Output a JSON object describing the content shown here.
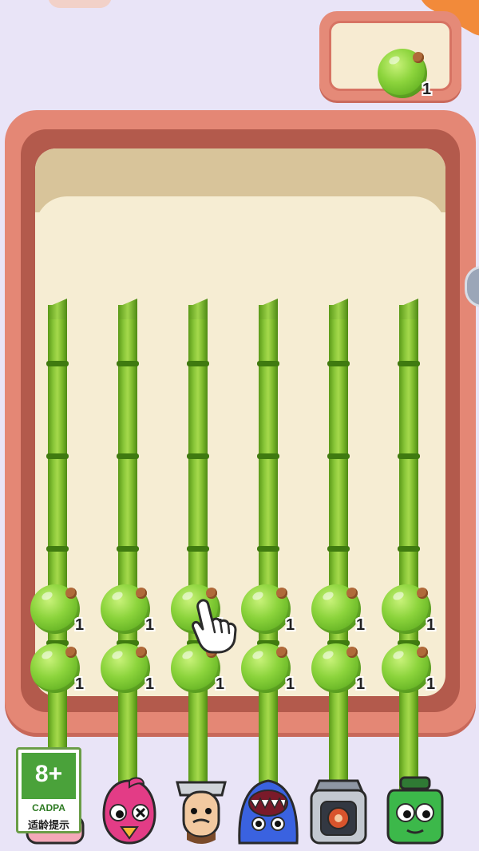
{
  "target": {
    "item": "green-fruit-ball",
    "count": "1"
  },
  "rods": [
    {
      "balls": [
        {
          "count": "1"
        },
        {
          "count": "1"
        }
      ]
    },
    {
      "balls": [
        {
          "count": "1"
        },
        {
          "count": "1"
        }
      ]
    },
    {
      "balls": [
        {
          "count": "1"
        },
        {
          "count": "1"
        }
      ]
    },
    {
      "balls": [
        {
          "count": "1"
        },
        {
          "count": "1"
        }
      ]
    },
    {
      "balls": [
        {
          "count": "1"
        },
        {
          "count": "1"
        }
      ]
    },
    {
      "balls": [
        {
          "count": "1"
        },
        {
          "count": "1"
        }
      ]
    }
  ],
  "characters": [
    "pink-bird-icon",
    "pink-monster-icon",
    "upside-down-man-icon",
    "blue-shark-monster-icon",
    "robot-box-icon",
    "green-bottle-monster-icon"
  ],
  "age_badge": {
    "age": "8+",
    "org": "CADPA",
    "tip": "适龄提示"
  },
  "colors": {
    "background": "#e9e4f7",
    "board": "#e48775",
    "board_inner": "#f6edd3",
    "bamboo": "#8bc83a",
    "ball": "#8cd43c"
  }
}
